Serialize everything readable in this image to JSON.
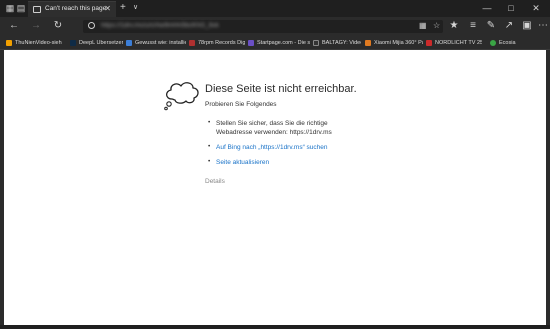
{
  "titlebar": {
    "tab_title": "Can't reach this page",
    "new_tab_label": "+",
    "tab_menu_label": "∨"
  },
  "navbar": {
    "url": "https://1drv.ms/u/s!Aw9mHn5bcKhG_8xk"
  },
  "favorites": [
    {
      "label": "ThuNienVideo-sieh",
      "color": "#f2a000"
    },
    {
      "label": "DeepL Übersetzer",
      "color": "#0f2b46"
    },
    {
      "label": "Gewusst wie: installie",
      "color": "#3b7ed8"
    },
    {
      "label": "78rpm Records Digiti",
      "color": "#b03030"
    },
    {
      "label": "Startpage.com - Die s",
      "color": "#6a4fc4"
    },
    {
      "label": "BALTAGY: Video",
      "color": "#333333"
    },
    {
      "label": "Xiaomi Mijia 360° Pan",
      "color": "#e07a20"
    },
    {
      "label": "NORDLICHT TV 25.0",
      "color": "#cc2a2a"
    },
    {
      "label": "Ecosia",
      "color": "#3aa545"
    }
  ],
  "error": {
    "title": "Diese Seite ist nicht erreichbar.",
    "subtitle": "Probieren Sie Folgendes",
    "suggestion_1_line1": "Stellen Sie sicher, dass Sie die richtige",
    "suggestion_1_line2": "Webadresse verwenden: https://1drv.ms",
    "suggestion_2": "Auf Bing nach „https://1drv.ms“ suchen",
    "suggestion_3": "Seite aktualisieren",
    "details": "Details"
  },
  "colors": {
    "link": "#1a73c8",
    "chrome_dark": "#2b2b2b"
  }
}
